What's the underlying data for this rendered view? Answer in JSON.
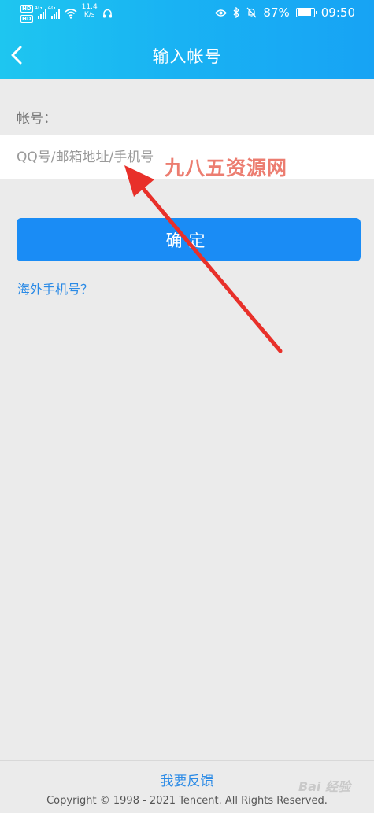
{
  "status_bar": {
    "hd1": "HD",
    "hd2": "HD",
    "net1": "4G",
    "net2": "4G",
    "speed_value": "11.4",
    "speed_unit": "K/s",
    "battery": "87%",
    "battery_level": 0.87,
    "time": "09:50"
  },
  "header": {
    "title": "输入帐号",
    "gradient_start": "#1ec6f0",
    "gradient_end": "#17a3f4"
  },
  "form": {
    "account_label": "帐号：",
    "account_placeholder": "QQ号/邮箱地址/手机号",
    "account_value": "",
    "confirm_label": "确定",
    "overseas_link": "海外手机号？"
  },
  "watermark": "九八五资源网",
  "footer": {
    "feedback_link": "我要反馈",
    "copyright": "Copyright © 1998 - 2021 Tencent. All Rights Reserved.",
    "baidu_mark": "Bai 经验"
  },
  "colors": {
    "accent": "#1a8cf5",
    "link": "#2a8ae6",
    "background": "#ebebeb",
    "annotation_arrow": "#e8302a"
  },
  "icons": [
    "back-chevron-icon",
    "eye-icon",
    "bluetooth-icon",
    "mute-bell-icon",
    "battery-icon",
    "wifi-icon",
    "signal-icon",
    "headset-icon"
  ]
}
